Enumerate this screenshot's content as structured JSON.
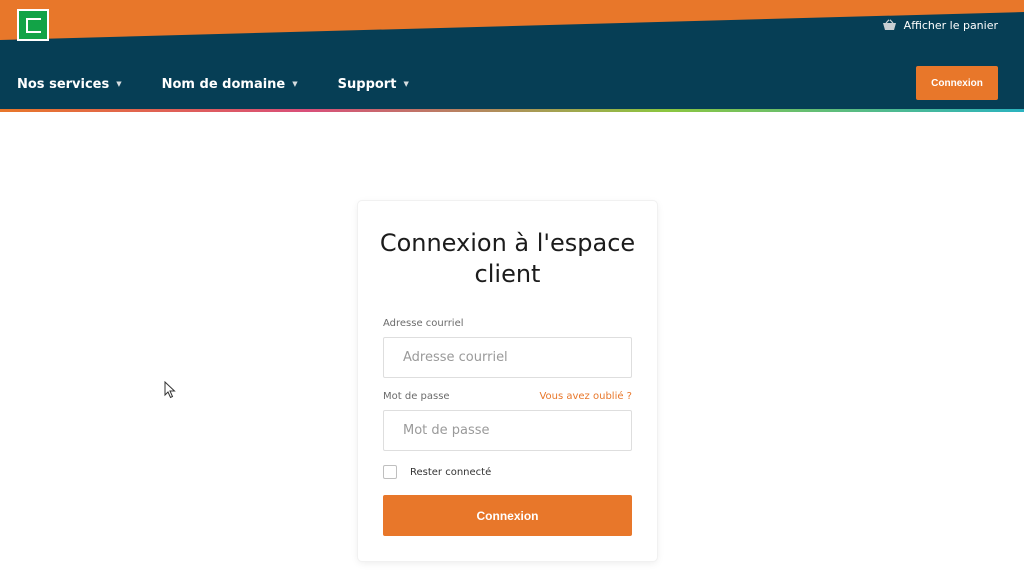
{
  "colors": {
    "header_bg": "#063e55",
    "accent_orange": "#e8772a",
    "logo_green": "#12a347",
    "link_orange": "#e8772a"
  },
  "header": {
    "logo_icon": "brand-logo-icon",
    "cart_icon": "basket-icon",
    "cart_label": "Afficher le panier",
    "login_button": "Connexion"
  },
  "nav": {
    "items": [
      {
        "label": "Nos services",
        "caret": "▼"
      },
      {
        "label": "Nom de domaine",
        "caret": "▼"
      },
      {
        "label": "Support",
        "caret": "▼"
      }
    ]
  },
  "login": {
    "title_line1": "Connexion à l'espace",
    "title_line2": "client",
    "email_label": "Adresse courriel",
    "email_placeholder": "Adresse courriel",
    "email_value": "",
    "password_label": "Mot de passe",
    "password_placeholder": "Mot de passe",
    "password_value": "",
    "forgot_link": "Vous avez oublié ?",
    "remember_label": "Rester connecté",
    "remember_checked": false,
    "submit_label": "Connexion"
  }
}
